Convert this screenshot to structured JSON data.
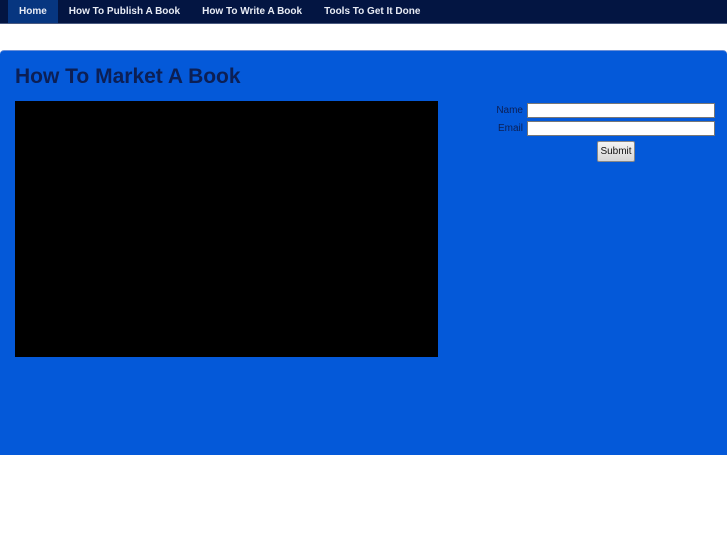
{
  "nav": {
    "items": [
      {
        "label": "Home",
        "active": true
      },
      {
        "label": "How To Publish A Book"
      },
      {
        "label": "How To Write A Book"
      },
      {
        "label": "Tools To Get It Done"
      }
    ]
  },
  "main": {
    "title": "How To Market A Book"
  },
  "form": {
    "name_label": "Name",
    "email_label": "Email",
    "name_value": "",
    "email_value": "",
    "submit_label": "Submit"
  }
}
